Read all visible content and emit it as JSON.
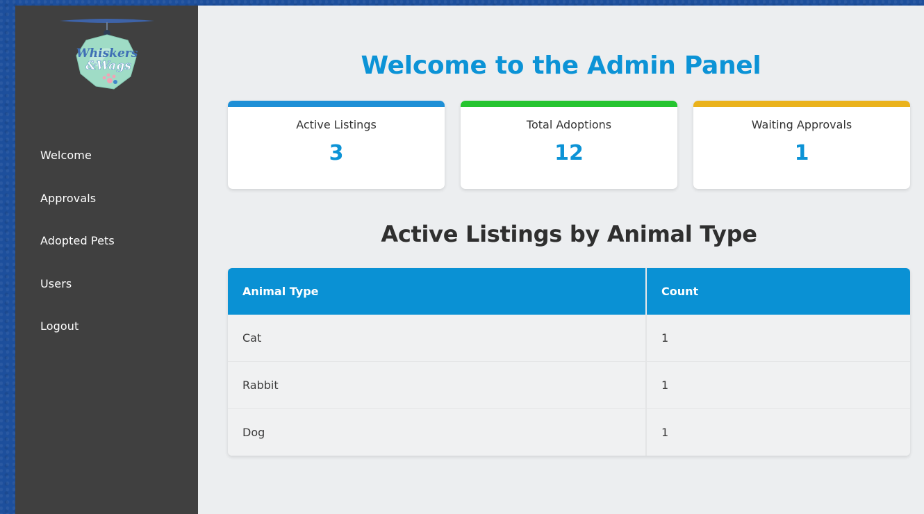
{
  "app": {
    "logo_text_line1": "Whiskers",
    "logo_text_line2": "&Wags"
  },
  "sidebar": {
    "items": [
      {
        "label": "Welcome"
      },
      {
        "label": "Approvals"
      },
      {
        "label": "Adopted Pets"
      },
      {
        "label": "Users"
      },
      {
        "label": "Logout"
      }
    ]
  },
  "main": {
    "title": "Welcome to the Admin Panel",
    "stats": [
      {
        "label": "Active Listings",
        "value": "3",
        "color": "#1e8fd6"
      },
      {
        "label": "Total Adoptions",
        "value": "12",
        "color": "#25c42f"
      },
      {
        "label": "Waiting Approvals",
        "value": "1",
        "color": "#eab21c"
      }
    ],
    "section_title": "Active Listings by Animal Type",
    "table": {
      "headers": [
        "Animal Type",
        "Count"
      ],
      "rows": [
        [
          "Cat",
          "1"
        ],
        [
          "Rabbit",
          "1"
        ],
        [
          "Dog",
          "1"
        ]
      ]
    }
  },
  "colors": {
    "accent": "#0c93d6",
    "sidebar_bg": "#404040",
    "main_bg": "#eceef0",
    "outer_bg": "#1d4f9c"
  }
}
